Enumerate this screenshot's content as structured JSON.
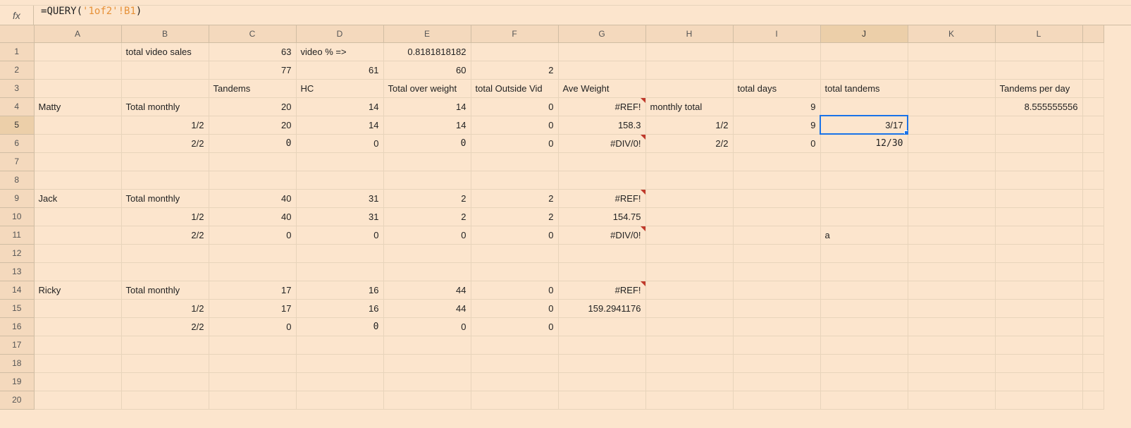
{
  "formula_bar": {
    "fx_label": "fx",
    "prefix": "=",
    "fn": "QUERY",
    "open": "(",
    "ref": "'1of2'!B1",
    "close": ")"
  },
  "columns": [
    "A",
    "B",
    "C",
    "D",
    "E",
    "F",
    "G",
    "H",
    "I",
    "J",
    "K",
    "L"
  ],
  "active_col": "J",
  "active_row": 5,
  "row_count": 20,
  "cells": {
    "B1": {
      "v": "total video sales",
      "a": "left"
    },
    "C1": {
      "v": "63",
      "a": "right"
    },
    "D1": {
      "v": "video % =>",
      "a": "left"
    },
    "E1": {
      "v": "0.8181818182",
      "a": "right"
    },
    "C2": {
      "v": "77",
      "a": "right"
    },
    "D2": {
      "v": "61",
      "a": "right"
    },
    "E2": {
      "v": "60",
      "a": "right"
    },
    "F2": {
      "v": "2",
      "a": "right"
    },
    "C3": {
      "v": "Tandems",
      "a": "left"
    },
    "D3": {
      "v": "HC",
      "a": "left"
    },
    "E3": {
      "v": "Total over weight",
      "a": "left"
    },
    "F3": {
      "v": "total Outside Vid",
      "a": "left"
    },
    "G3": {
      "v": "Ave Weight",
      "a": "left"
    },
    "I3": {
      "v": "total days",
      "a": "left"
    },
    "J3": {
      "v": "total tandems",
      "a": "left"
    },
    "L3": {
      "v": "Tandems per day",
      "a": "left"
    },
    "A4": {
      "v": "Matty",
      "a": "left"
    },
    "B4": {
      "v": "Total monthly",
      "a": "left"
    },
    "C4": {
      "v": "20",
      "a": "right"
    },
    "D4": {
      "v": "14",
      "a": "right"
    },
    "E4": {
      "v": "14",
      "a": "right"
    },
    "F4": {
      "v": "0",
      "a": "right"
    },
    "G4": {
      "v": "#REF!",
      "a": "right",
      "err": true
    },
    "H4": {
      "v": "monthly total",
      "a": "left"
    },
    "I4": {
      "v": "9",
      "a": "right"
    },
    "L4": {
      "v": "8.555555556",
      "a": "right"
    },
    "B5": {
      "v": "1/2",
      "a": "right"
    },
    "C5": {
      "v": "20",
      "a": "right"
    },
    "D5": {
      "v": "14",
      "a": "right"
    },
    "E5": {
      "v": "14",
      "a": "right"
    },
    "F5": {
      "v": "0",
      "a": "right"
    },
    "G5": {
      "v": "158.3",
      "a": "right"
    },
    "H5": {
      "v": "1/2",
      "a": "right"
    },
    "I5": {
      "v": "9",
      "a": "right"
    },
    "J5": {
      "v": "3/17",
      "a": "right",
      "sel": true
    },
    "B6": {
      "v": "2/2",
      "a": "right"
    },
    "C6": {
      "v": "0",
      "a": "right",
      "mono": true
    },
    "D6": {
      "v": "0",
      "a": "right"
    },
    "E6": {
      "v": "0",
      "a": "right",
      "mono": true
    },
    "F6": {
      "v": "0",
      "a": "right"
    },
    "G6": {
      "v": "#DIV/0!",
      "a": "right",
      "err": true
    },
    "H6": {
      "v": "2/2",
      "a": "right"
    },
    "I6": {
      "v": "0",
      "a": "right"
    },
    "J6": {
      "v": "12/30",
      "a": "right",
      "mono": true
    },
    "A9": {
      "v": "Jack",
      "a": "left"
    },
    "B9": {
      "v": "Total monthly",
      "a": "left"
    },
    "C9": {
      "v": "40",
      "a": "right"
    },
    "D9": {
      "v": "31",
      "a": "right"
    },
    "E9": {
      "v": "2",
      "a": "right"
    },
    "F9": {
      "v": "2",
      "a": "right"
    },
    "G9": {
      "v": "#REF!",
      "a": "right",
      "err": true
    },
    "B10": {
      "v": "1/2",
      "a": "right"
    },
    "C10": {
      "v": "40",
      "a": "right"
    },
    "D10": {
      "v": "31",
      "a": "right"
    },
    "E10": {
      "v": "2",
      "a": "right"
    },
    "F10": {
      "v": "2",
      "a": "right"
    },
    "G10": {
      "v": "154.75",
      "a": "right"
    },
    "B11": {
      "v": "2/2",
      "a": "right"
    },
    "C11": {
      "v": "0",
      "a": "right"
    },
    "D11": {
      "v": "0",
      "a": "right"
    },
    "E11": {
      "v": "0",
      "a": "right"
    },
    "F11": {
      "v": "0",
      "a": "right"
    },
    "G11": {
      "v": "#DIV/0!",
      "a": "right",
      "err": true
    },
    "J11": {
      "v": "a",
      "a": "left"
    },
    "A14": {
      "v": "Ricky",
      "a": "left"
    },
    "B14": {
      "v": "Total monthly",
      "a": "left"
    },
    "C14": {
      "v": "17",
      "a": "right"
    },
    "D14": {
      "v": "16",
      "a": "right"
    },
    "E14": {
      "v": "44",
      "a": "right"
    },
    "F14": {
      "v": "0",
      "a": "right"
    },
    "G14": {
      "v": "#REF!",
      "a": "right",
      "err": true
    },
    "B15": {
      "v": "1/2",
      "a": "right"
    },
    "C15": {
      "v": "17",
      "a": "right"
    },
    "D15": {
      "v": "16",
      "a": "right"
    },
    "E15": {
      "v": "44",
      "a": "right"
    },
    "F15": {
      "v": "0",
      "a": "right"
    },
    "G15": {
      "v": "159.2941176",
      "a": "right"
    },
    "B16": {
      "v": "2/2",
      "a": "right"
    },
    "C16": {
      "v": "0",
      "a": "right"
    },
    "D16": {
      "v": "0",
      "a": "right",
      "mono": true
    },
    "E16": {
      "v": "0",
      "a": "right"
    },
    "F16": {
      "v": "0",
      "a": "right"
    }
  }
}
